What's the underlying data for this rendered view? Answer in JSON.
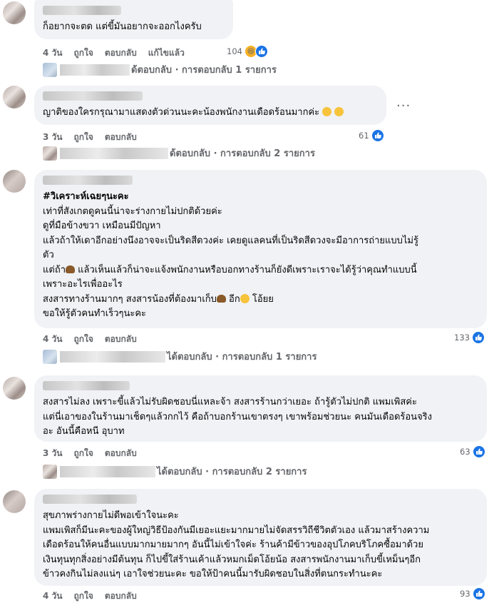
{
  "comments": [
    {
      "lines": [
        "ก็อยากจะตด แต่ขี้มันอยากจะออกไงครับ"
      ],
      "time": "4 วัน",
      "like": "ถูกใจ",
      "reply": "ตอบกลับ",
      "edited": "แก้ไขแล้ว",
      "count": "104",
      "reactions": [
        "haha-icon",
        "like-icon"
      ]
    },
    {
      "lines": [
        "ญาติของใครกรุณามาแสดงตัวด่วนนะคะน้องพนักงานเดือดร้อนมากค่ะ"
      ],
      "time": "3 วัน",
      "like": "ถูกใจ",
      "reply": "ตอบกลับ",
      "count": "61"
    },
    {
      "heading": "#วิเคราะห์เฉยๆนะคะ",
      "lines": [
        "เท่าที่สังเกตดูคนนี้น่าจะร่างกายไม่ปกติด้วยค่ะ",
        "ดูที่มือข้างขวา เหมือนมีปัญหา",
        "แล้วถ้าให้เดาอีกอย่างนึงอาจจะเป็นริดสีดวงค่ะ เคยดูแลคนที่เป็นริดสีดวงจะมีอาการถ่ายแบบไม่รู้",
        "ตัว",
        "แต่ถ้า",
        "เพราะอะไรเพื่ออะไร",
        "สงสารทางร้านมากๆ สงสารน้องที่ต้องมาเก็บ",
        "ขอให้รู้ตัวคนทำเร็วๆนะคะ"
      ],
      "line5_rest": " แล้วเห็นแล้วก็น่าจะแจ้งพนักงานหรือบอกทางร้านก็ยังดีเพราะเราจะได้รู้ว่าคุณทำแบบนี้",
      "line7_rest": " อีก",
      "line7_end": " โอ้ยย",
      "time": "4 วัน",
      "like": "ถูกใจ",
      "reply": "ตอบกลับ",
      "count": "133"
    },
    {
      "lines": [
        "สงสารไม่ลง เพราะขี้แล้วไม่รับผิดชอบนี่แหละจ้า สงสารร้านกว่าเยอะ ถ้ารู้ตัวไม่ปกติ แพมเพิสค่ะ",
        "แต่นี่เอาของในร้านมาเช็ดๆแล้วกกไว้ คือถ้าบอกร้านเขาตรงๆ เขาพร้อมช่วยนะ คนมันเดือดร้อนจริง",
        "อะ อันนี้คือหนี อุบาท"
      ],
      "time": "3 วัน",
      "like": "ถูกใจ",
      "reply": "ตอบกลับ",
      "count": "63"
    },
    {
      "lines": [
        "สุขภาพร่างกายไม่ดีพอเข้าใจนะคะ",
        "แพมเพิสก็มีนะคะของผู้ใหญ่วิธีป้องกันมีเยอะแยะมากมายไม่จัดสรรวิถีชีวิตตัวเอง แล้วมาสร้างความ",
        "เดือดร้อนให้คนอื่นแบบมากมายมากๆ อันนี้ไม่เข้าใจค่ะ ร้านค้ามีข้าวของอุปโภคบริโภคซื้อมาด้วย",
        "เงินทุนทุกสิ่งอย่างมีต้นทุน ก็ไปขี้ใส่ร้านเค้าแล้วหมกเม็ดโอ้ยน้อ สงสารพนักงานมาเก็บขี้เหม็นๆอีก",
        "ข้าวคงกินไม่ลงแน่ๆ เอาใจช่วยนะคะ ขอให้ป้าคนนี้มารับผิดชอบในสิ่งที่ตนกระทำนะคะ"
      ],
      "time": "4 วัน",
      "like": "ถูกใจ",
      "reply": "ตอบกลับ",
      "count": "93"
    }
  ],
  "replies": [
    {
      "prefix": "ด้",
      "text": "ตอบกลับ · การตอบกลับ 1 รายการ"
    },
    {
      "prefix": "ด้",
      "text": "ตอบกลับ · การตอบกลับ 2 รายการ"
    },
    {
      "prefix": "ได้",
      "text": "ตอบกลับ · การตอบกลับ 1 รายการ"
    },
    {
      "prefix": "ได้",
      "text": "ตอบกลับ · การตอบกลับ 2 รายการ"
    }
  ],
  "more_menu": "···"
}
